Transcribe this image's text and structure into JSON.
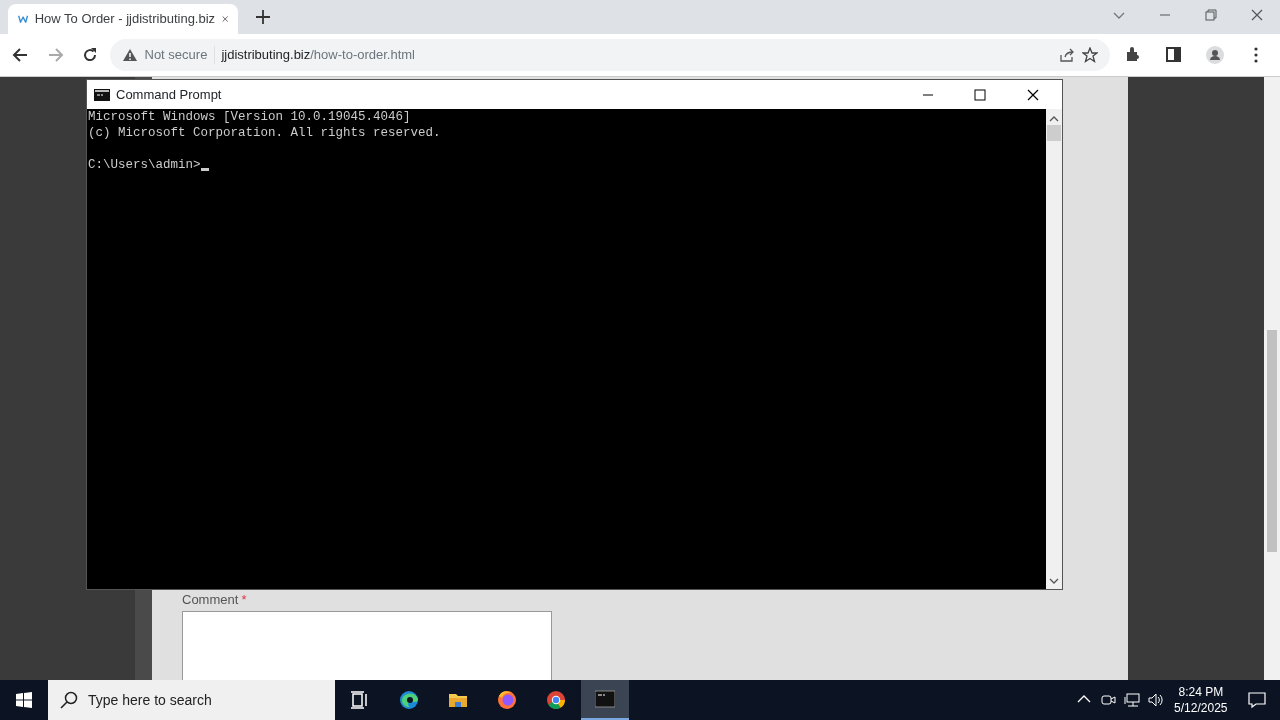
{
  "browser": {
    "tab": {
      "title": "How To Order - jjdistributing.biz",
      "selected": true
    },
    "address": {
      "security": "Not secure",
      "host": "jjdistributing.biz",
      "path": "/how-to-order.html"
    }
  },
  "page": {
    "field": {
      "label": "Comment",
      "required_mark": "*"
    }
  },
  "console_window": {
    "title": "Command Prompt",
    "banner": [
      "Microsoft Windows [Version 10.0.19045.4046]",
      "(c) Microsoft Corporation. All rights reserved."
    ],
    "prompt": "C:\\Users\\admin>"
  },
  "taskbar": {
    "search": {
      "placeholder": "Type here to search"
    },
    "apps": [
      {
        "kind": "taskview",
        "active": false
      },
      {
        "kind": "edge",
        "active": false
      },
      {
        "kind": "explorer",
        "active": false
      },
      {
        "kind": "firefox",
        "active": false
      },
      {
        "kind": "chrome",
        "active": false
      },
      {
        "kind": "terminal",
        "active": true
      }
    ],
    "clock": {
      "time": "8:24 PM",
      "date": "5/12/2025"
    }
  }
}
